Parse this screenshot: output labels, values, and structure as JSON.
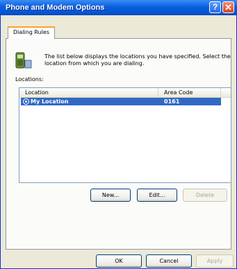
{
  "window": {
    "title": "Phone and Modem Options"
  },
  "tabs": [
    {
      "label": "Dialing Rules"
    }
  ],
  "description": "The list below displays the locations you have specified. Select the location from which you are dialing.",
  "locations": {
    "label": "Locations:",
    "columns": [
      "Location",
      "Area Code"
    ],
    "rows": [
      {
        "location": "My Location",
        "area_code": "0161",
        "selected": true
      }
    ]
  },
  "list_buttons": {
    "new": "New...",
    "edit": "Edit...",
    "delete": "Delete"
  },
  "footer_buttons": {
    "ok": "OK",
    "cancel": "Cancel",
    "apply": "Apply"
  },
  "colors": {
    "selection": "#316ac5",
    "titlebar": "#0554d2",
    "tab_accent": "#f8a428"
  },
  "icons": [
    "help-icon",
    "close-icon",
    "phone-icon"
  ]
}
